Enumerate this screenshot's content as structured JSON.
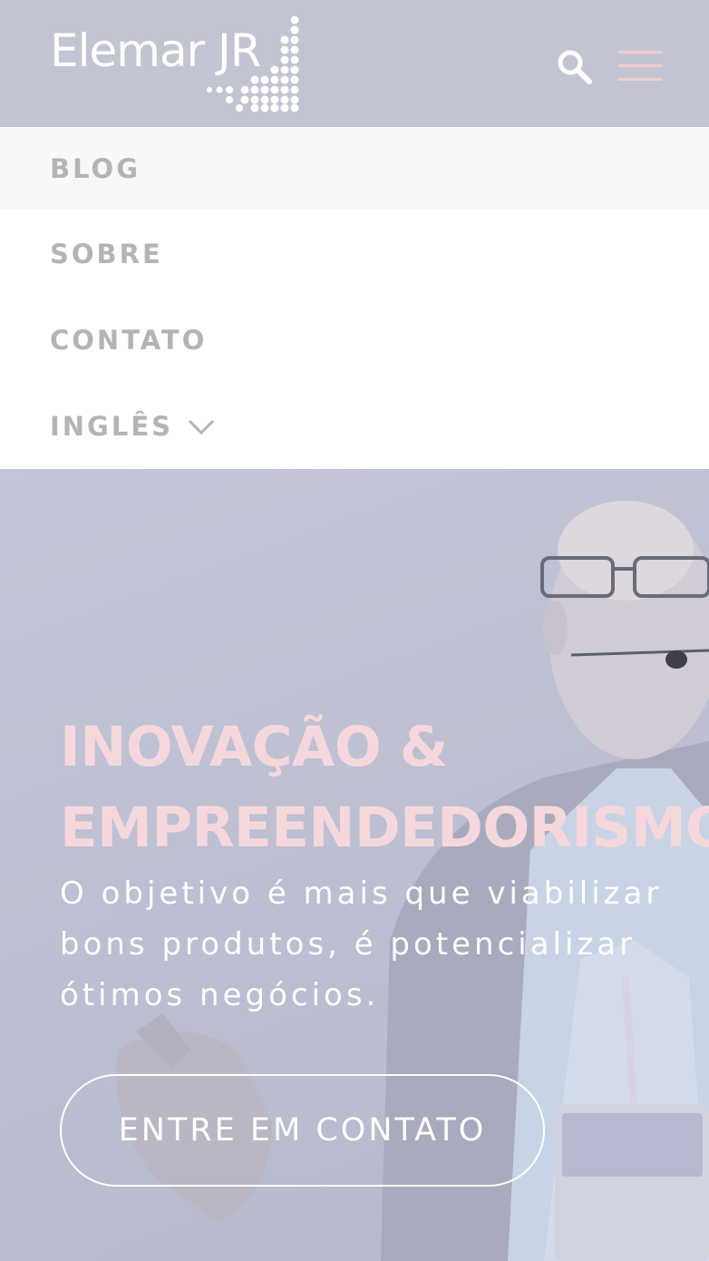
{
  "header": {
    "logo_text": "Elemar JR",
    "search_icon": "search-icon",
    "menu_icon": "hamburger-menu-icon",
    "menu_color": "#f4c9cf"
  },
  "nav": {
    "items": [
      {
        "label": "BLOG",
        "active": true
      },
      {
        "label": "SOBRE"
      },
      {
        "label": "CONTATO"
      },
      {
        "label": "INGLÊS",
        "icon": "chevron-down-icon"
      }
    ]
  },
  "hero": {
    "title_line1": "INOVAÇÃO &",
    "title_line2": "EMPREENDEDORISMO",
    "subtitle": "O objetivo é mais que viabilizar bons produtos, é potencializar ótimos negócios.",
    "cta_label": "ENTRE EM CONTATO",
    "title_color": "#f6d8dc"
  }
}
